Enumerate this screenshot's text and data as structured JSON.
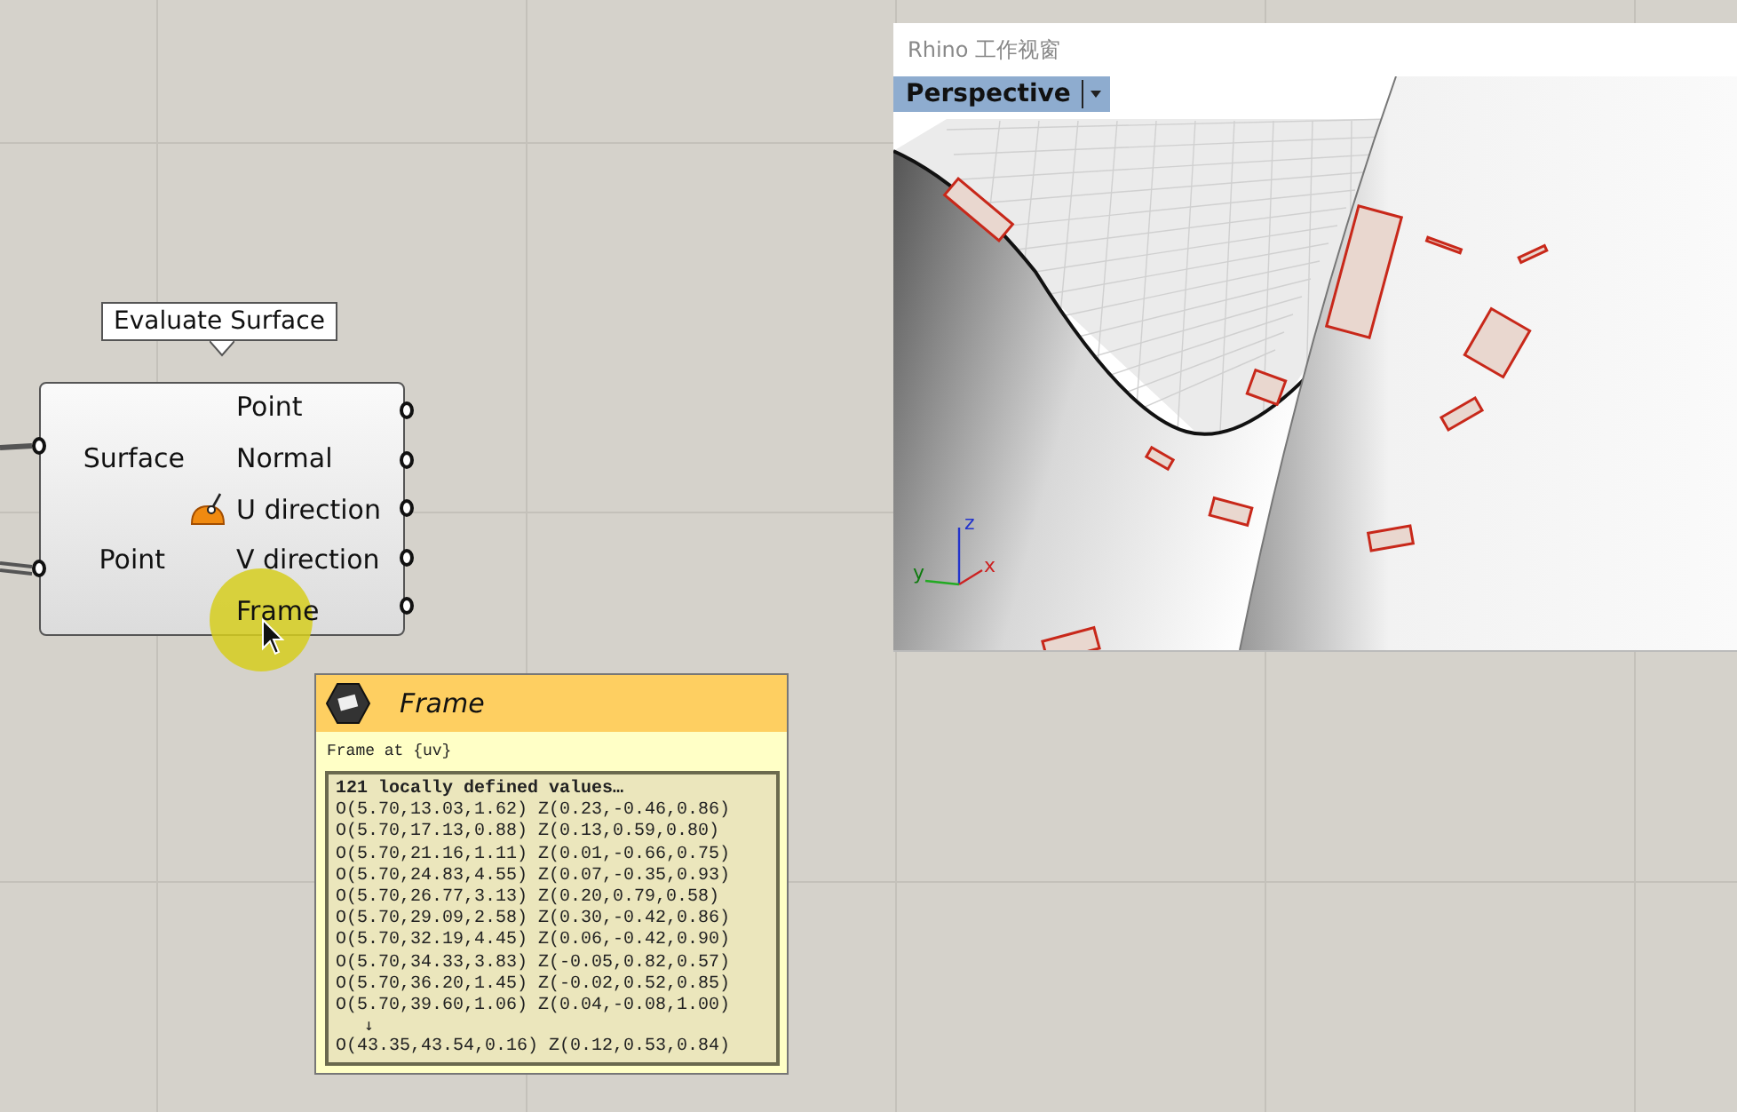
{
  "component": {
    "title": "Evaluate Surface",
    "inputs": [
      "Surface",
      "Point"
    ],
    "outputs": [
      "Point",
      "Normal",
      "U direction",
      "V direction",
      "Frame"
    ]
  },
  "viewport": {
    "title": "Rhino 工作视窗",
    "view": "Perspective",
    "axes": [
      "x",
      "y",
      "z"
    ]
  },
  "tooltip": {
    "title": "Frame",
    "description": "Frame at {uv}",
    "values_header": "121 locally defined values…",
    "rows": [
      "O(5.70,13.03,1.62) Z(0.23,-0.46,0.86)",
      "O(5.70,17.13,0.88) Z(0.13,0.59,0.80)",
      "O(5.70,21.16,1.11) Z(0.01,-0.66,0.75)",
      "O(5.70,24.83,4.55) Z(0.07,-0.35,0.93)",
      "O(5.70,26.77,3.13) Z(0.20,0.79,0.58)",
      "O(5.70,29.09,2.58) Z(0.30,-0.42,0.86)",
      "O(5.70,32.19,4.45) Z(0.06,-0.42,0.90)",
      "O(5.70,34.33,3.83) Z(-0.05,0.82,0.57)",
      "O(5.70,36.20,1.45) Z(-0.02,0.52,0.85)",
      "O(5.70,39.60,1.06) Z(0.04,-0.08,1.00)"
    ],
    "gap_marker": "↓",
    "last_row": "O(43.35,43.54,0.16) Z(0.12,0.53,0.84)"
  }
}
